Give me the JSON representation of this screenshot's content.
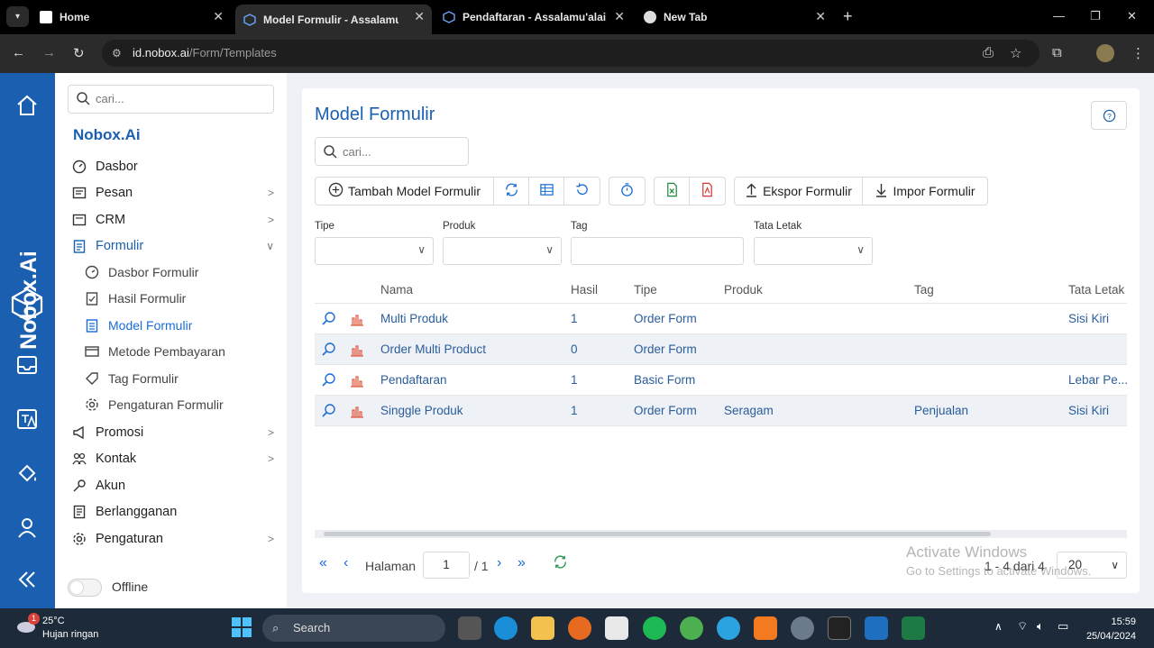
{
  "browser": {
    "tabs": [
      {
        "title": "Home",
        "active": false
      },
      {
        "title": "Model Formulir - Assalamu'ala",
        "active": true
      },
      {
        "title": "Pendaftaran - Assalamu'alaiku",
        "active": false
      },
      {
        "title": "New Tab",
        "active": false
      }
    ],
    "url_host": "id.nobox.ai",
    "url_path": "/Form/Templates"
  },
  "rail": {
    "brand": "Nobox.Ai"
  },
  "sidebar": {
    "search_placeholder": "cari...",
    "brand": "Nobox.Ai",
    "items": [
      {
        "label": "Dasbor",
        "icon": "dashboard-icon",
        "chevron": false
      },
      {
        "label": "Pesan",
        "icon": "message-icon",
        "chevron": true
      },
      {
        "label": "CRM",
        "icon": "crm-icon",
        "chevron": true
      },
      {
        "label": "Formulir",
        "icon": "form-icon",
        "chevron": true,
        "active": true
      },
      {
        "label": "Promosi",
        "icon": "megaphone-icon",
        "chevron": true
      },
      {
        "label": "Kontak",
        "icon": "contacts-icon",
        "chevron": true
      },
      {
        "label": "Akun",
        "icon": "key-icon",
        "chevron": false
      },
      {
        "label": "Berlangganan",
        "icon": "subscription-icon",
        "chevron": false
      },
      {
        "label": "Pengaturan",
        "icon": "gear-icon",
        "chevron": true
      }
    ],
    "subitems": [
      {
        "label": "Dasbor Formulir",
        "icon": "gauge-icon"
      },
      {
        "label": "Hasil Formulir",
        "icon": "clipboard-check-icon"
      },
      {
        "label": "Model Formulir",
        "icon": "clipboard-list-icon",
        "active": true
      },
      {
        "label": "Metode Pembayaran",
        "icon": "card-icon"
      },
      {
        "label": "Tag Formulir",
        "icon": "tag-icon"
      },
      {
        "label": "Pengaturan Formulir",
        "icon": "gear-icon"
      }
    ],
    "status_label": "Offline"
  },
  "main": {
    "title": "Model Formulir",
    "search_placeholder": "cari...",
    "toolbar": {
      "add_label": "Tambah Model Formulir",
      "export_label": "Ekspor Formulir",
      "import_label": "Impor Formulir"
    },
    "filters": {
      "tipe_label": "Tipe",
      "produk_label": "Produk",
      "tag_label": "Tag",
      "tata_letak_label": "Tata Letak"
    },
    "table": {
      "columns": [
        "Nama",
        "Hasil",
        "Tipe",
        "Produk",
        "Tag",
        "Tata Letak"
      ],
      "rows": [
        {
          "nama": "Multi Produk",
          "hasil": "1",
          "tipe": "Order Form",
          "produk": "",
          "tag": "",
          "tata_letak": "Sisi Kiri"
        },
        {
          "nama": "Order Multi Product",
          "hasil": "0",
          "tipe": "Order Form",
          "produk": "",
          "tag": "",
          "tata_letak": ""
        },
        {
          "nama": "Pendaftaran",
          "hasil": "1",
          "tipe": "Basic Form",
          "produk": "",
          "tag": "",
          "tata_letak": "Lebar Pe..."
        },
        {
          "nama": "Singgle Produk",
          "hasil": "1",
          "tipe": "Order Form",
          "produk": "Seragam",
          "tag": "Penjualan",
          "tata_letak": "Sisi Kiri"
        }
      ]
    },
    "pager": {
      "page_label": "Halaman",
      "page_value": "1",
      "page_total": "/ 1",
      "range_text": "1 - 4 dari 4",
      "page_size": "20"
    }
  },
  "watermark": {
    "line1": "Activate Windows",
    "line2": "Go to Settings to activate Windows."
  },
  "taskbar": {
    "temperature": "25°C",
    "weather": "Hujan ringan",
    "weather_badge": "1",
    "search_label": "Search",
    "time": "15:59",
    "date": "25/04/2024"
  }
}
